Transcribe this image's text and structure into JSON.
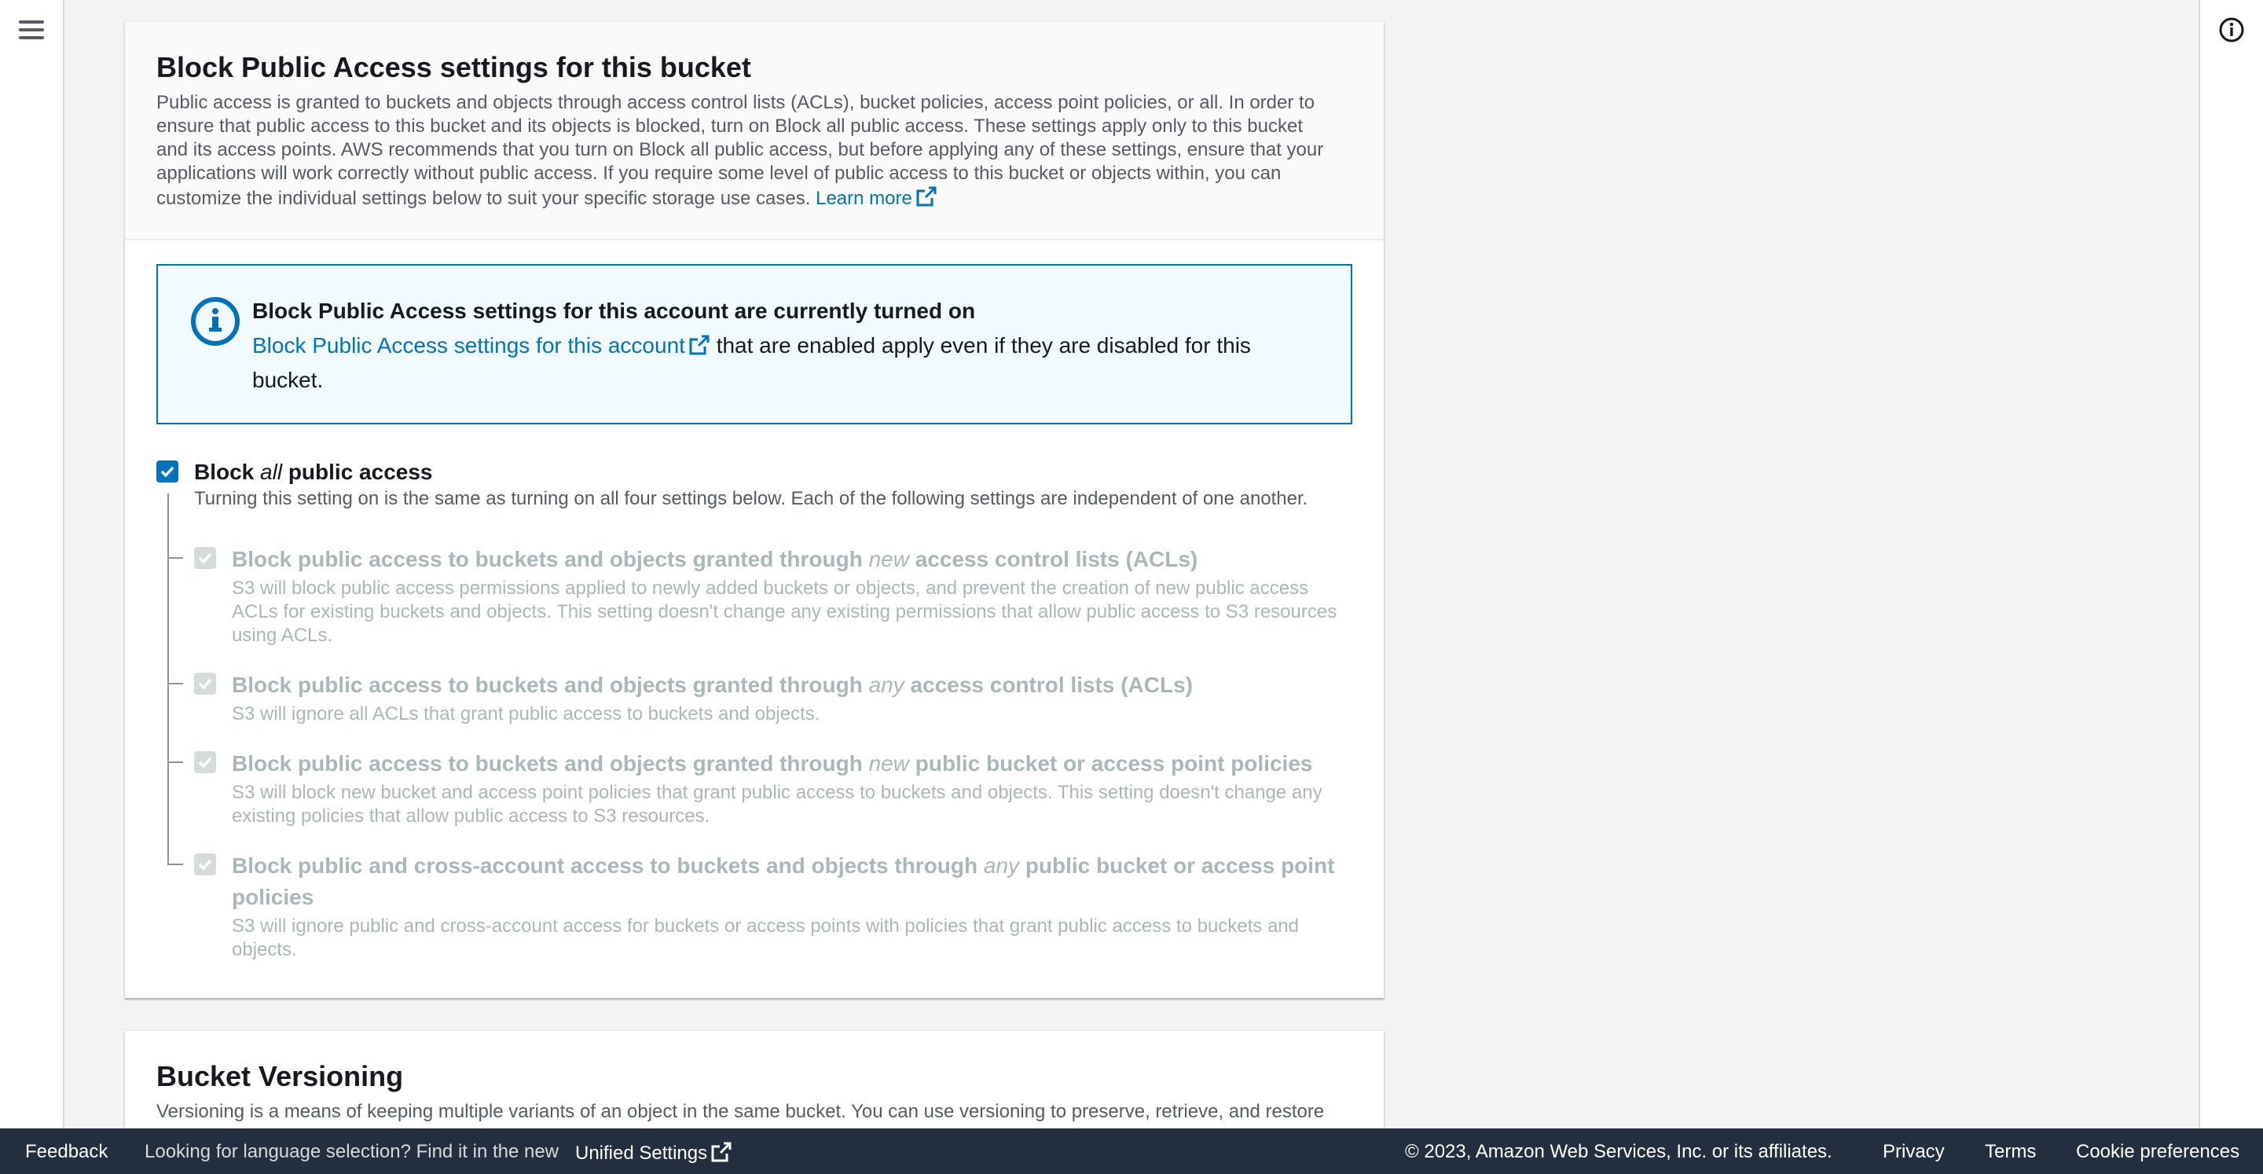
{
  "nav": {
    "menu_icon": "hamburger-menu-icon",
    "info_icon": "info-icon"
  },
  "bpa": {
    "title": "Block Public Access settings for this bucket",
    "description_lines": [
      "Public access is granted to buckets and objects through access control lists (ACLs), bucket policies, access point policies, or all. In order to",
      "ensure that public access to this bucket and its objects is blocked, turn on Block all public access. These settings apply only to this bucket",
      "and its access points. AWS recommends that you turn on Block all public access, but before applying any of these settings, ensure that your",
      "applications will work correctly without public access. If you require some level of public access to this bucket or objects within, you can",
      "customize the individual settings below to suit your specific storage use cases."
    ],
    "learn_more": "Learn more",
    "alert": {
      "title": "Block Public Access settings for this account are currently turned on",
      "link": "Block Public Access settings for this account",
      "text_after_link": "that are enabled apply even if they are disabled for this",
      "text_line2": "bucket."
    },
    "block_all": {
      "label_pre": "Block ",
      "label_em": "all",
      "label_post": " public access",
      "checked": true,
      "description": "Turning this setting on is the same as turning on all four settings below. Each of the following settings are independent of one another."
    },
    "options": [
      {
        "label_pre": "Block public access to buckets and objects granted through ",
        "label_em": "new",
        "label_post": " access control lists (ACLs)",
        "description": "S3 will block public access permissions applied to newly added buckets or objects, and prevent the creation of new public access ACLs for existing buckets and objects. This setting doesn't change any existing permissions that allow public access to S3 resources using ACLs.",
        "checked": true,
        "disabled": true
      },
      {
        "label_pre": "Block public access to buckets and objects granted through ",
        "label_em": "any",
        "label_post": " access control lists (ACLs)",
        "description": "S3 will ignore all ACLs that grant public access to buckets and objects.",
        "checked": true,
        "disabled": true
      },
      {
        "label_pre": "Block public access to buckets and objects granted through ",
        "label_em": "new",
        "label_post": " public bucket or access point policies",
        "description": "S3 will block new bucket and access point policies that grant public access to buckets and objects. This setting doesn't change any existing policies that allow public access to S3 resources.",
        "checked": true,
        "disabled": true
      },
      {
        "label_pre": "Block public and cross-account access to buckets and objects through ",
        "label_em": "any",
        "label_post": " public bucket or access point policies",
        "description": "S3 will ignore public and cross-account access for buckets or access points with policies that grant public access to buckets and objects.",
        "checked": true,
        "disabled": true
      }
    ]
  },
  "versioning": {
    "title": "Bucket Versioning",
    "description": "Versioning is a means of keeping multiple variants of an object in the same bucket. You can use versioning to preserve, retrieve, and restore"
  },
  "footer": {
    "feedback": "Feedback",
    "language_text": "Looking for language selection? Find it in the new",
    "unified_settings": "Unified Settings",
    "copyright": "© 2023, Amazon Web Services, Inc. or its affiliates.",
    "privacy": "Privacy",
    "terms": "Terms",
    "cookie_preferences": "Cookie preferences"
  },
  "colors": {
    "link": "#0073bb",
    "footer_bg": "#232f3e",
    "checkbox_on": "#0073bb",
    "checkbox_disabled": "#d5dbdb"
  }
}
